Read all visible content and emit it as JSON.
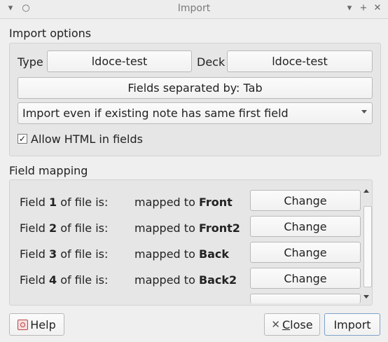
{
  "window": {
    "title": "Import",
    "menu_glyph": "▾",
    "pin_glyph": "○",
    "min_glyph": "▾",
    "max_glyph": "+",
    "close_glyph": "✕"
  },
  "import_options": {
    "title": "Import options",
    "type_label": "Type",
    "type_value": "ldoce-test",
    "deck_label": "Deck",
    "deck_value": "ldoce-test",
    "fields_separated": "Fields separated by: Tab",
    "duplicate_mode": "Import even if existing note has same first field",
    "allow_html_label": "Allow HTML in fields",
    "allow_html_checked": "✓"
  },
  "field_mapping": {
    "title": "Field mapping",
    "rows": [
      {
        "field_prefix": "Field ",
        "field_num": "1",
        "field_suffix": " of file is:",
        "mapped_prefix": "mapped to ",
        "target": "Front",
        "button": "Change"
      },
      {
        "field_prefix": "Field ",
        "field_num": "2",
        "field_suffix": " of file is:",
        "mapped_prefix": "mapped to ",
        "target": "Front2",
        "button": "Change"
      },
      {
        "field_prefix": "Field ",
        "field_num": "3",
        "field_suffix": " of file is:",
        "mapped_prefix": "mapped to ",
        "target": "Back",
        "button": "Change"
      },
      {
        "field_prefix": "Field ",
        "field_num": "4",
        "field_suffix": " of file is:",
        "mapped_prefix": "mapped to ",
        "target": "Back2",
        "button": "Change"
      }
    ]
  },
  "footer": {
    "help": "Help",
    "close_mnemonic": "C",
    "close_rest": "lose",
    "import": "Import"
  }
}
